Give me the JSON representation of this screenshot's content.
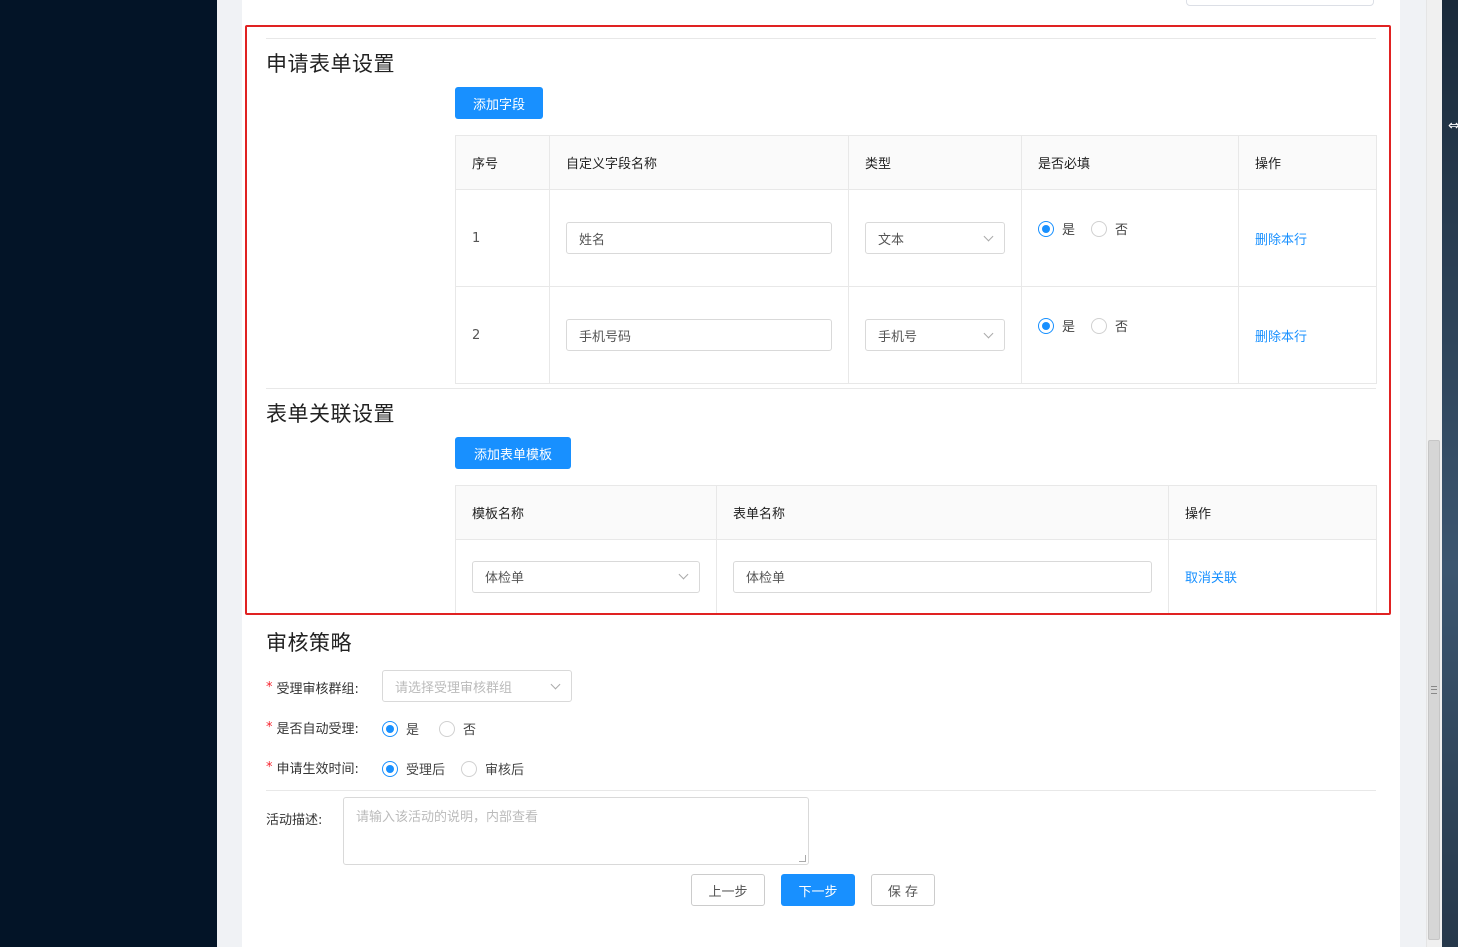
{
  "form_settings": {
    "title": "申请表单设置",
    "add_field_button": "添加字段",
    "columns": [
      "序号",
      "自定义字段名称",
      "类型",
      "是否必填",
      "操作"
    ],
    "rows": [
      {
        "index": "1",
        "field_name": "姓名",
        "type": "文本",
        "required_yes": "是",
        "required_no": "否",
        "required": "是",
        "action": "删除本行"
      },
      {
        "index": "2",
        "field_name": "手机号码",
        "type": "手机号",
        "required_yes": "是",
        "required_no": "否",
        "required": "是",
        "action": "删除本行"
      }
    ]
  },
  "form_link_settings": {
    "title": "表单关联设置",
    "add_template_button": "添加表单模板",
    "columns": [
      "模板名称",
      "表单名称",
      "操作"
    ],
    "rows": [
      {
        "template_name": "体检单",
        "form_name": "体检单",
        "action": "取消关联"
      }
    ]
  },
  "review_policy": {
    "title": "审核策略",
    "review_group_label": "受理审核群组:",
    "review_group_placeholder": "请选择受理审核群组",
    "auto_accept_label": "是否自动受理:",
    "auto_accept_yes": "是",
    "auto_accept_no": "否",
    "auto_accept_value": "是",
    "effective_time_label": "申请生效时间:",
    "effective_after_accept": "受理后",
    "effective_after_review": "审核后",
    "effective_value": "受理后"
  },
  "activity": {
    "description_label": "活动描述:",
    "description_placeholder": "请输入该活动的说明，内部查看"
  },
  "footer": {
    "prev_button": "上一步",
    "next_button": "下一步",
    "save_button": "保 存"
  },
  "colors": {
    "primary": "#1890ff",
    "highlight_border": "#e02222",
    "sidebar": "#031427",
    "required_mark": "#f5222d"
  }
}
